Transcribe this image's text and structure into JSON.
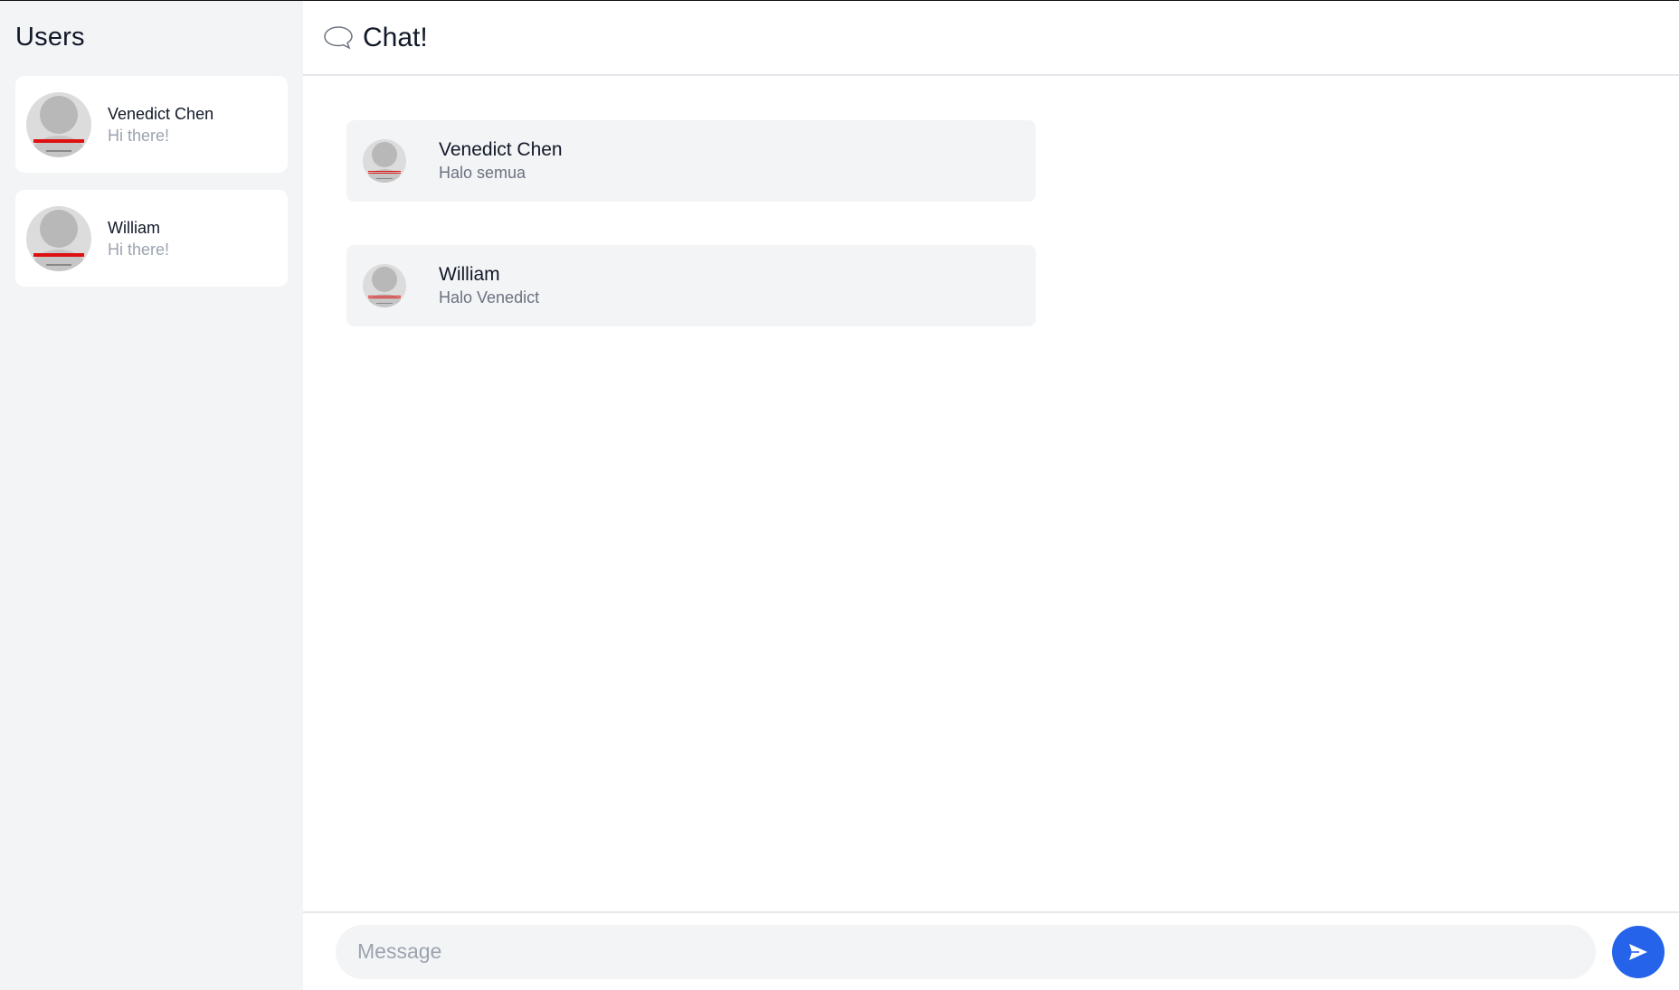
{
  "sidebar": {
    "title": "Users",
    "users": [
      {
        "name": "Venedict Chen",
        "preview": "Hi there!"
      },
      {
        "name": "William",
        "preview": "Hi there!"
      }
    ]
  },
  "header": {
    "title": "Chat!",
    "icon": "chat-bubble-icon"
  },
  "messages": [
    {
      "name": "Venedict Chen",
      "text": "Halo semua"
    },
    {
      "name": "William",
      "text": "Halo Venedict"
    }
  ],
  "composer": {
    "placeholder": "Message",
    "send_icon": "send-icon"
  },
  "colors": {
    "accent": "#2563eb",
    "sidebar_bg": "#f3f4f6",
    "bubble_bg": "#f3f4f6"
  }
}
